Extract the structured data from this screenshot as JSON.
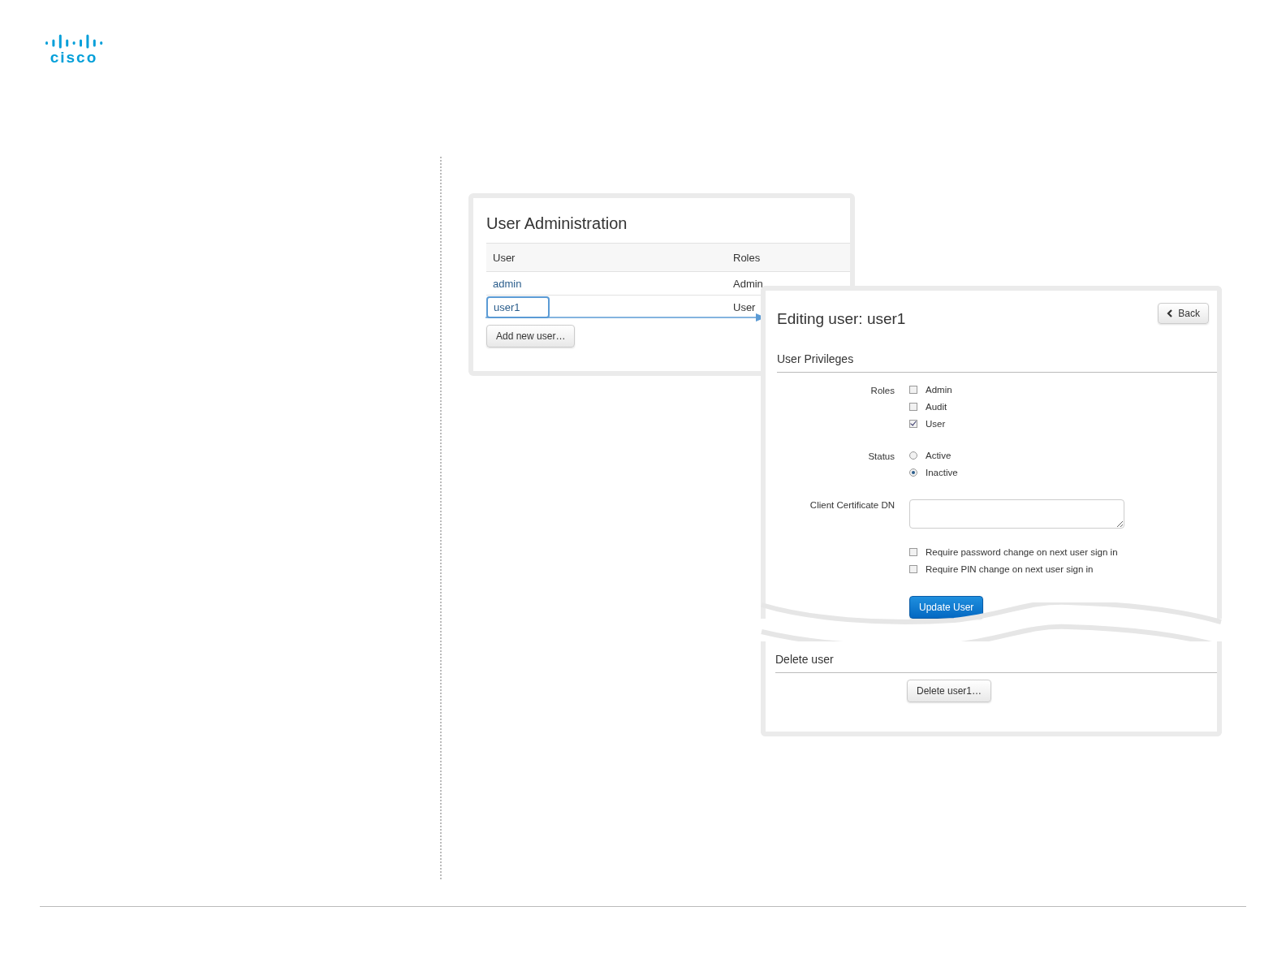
{
  "logo": {
    "text": "cisco"
  },
  "user_administration": {
    "title": "User Administration",
    "columns": [
      "User",
      "Roles"
    ],
    "rows": [
      {
        "user": "admin",
        "roles": "Admin",
        "selected": false
      },
      {
        "user": "user1",
        "roles": "User",
        "selected": true
      }
    ],
    "add_button": "Add new user…"
  },
  "editing_user": {
    "title": "Editing user: user1",
    "back_button": "Back",
    "section": "User Privileges",
    "roles_label": "Roles",
    "roles": [
      {
        "label": "Admin",
        "checked": false
      },
      {
        "label": "Audit",
        "checked": false
      },
      {
        "label": "User",
        "checked": true
      }
    ],
    "status_label": "Status",
    "status": [
      {
        "label": "Active",
        "selected": false
      },
      {
        "label": "Inactive",
        "selected": true
      }
    ],
    "certificate_label": "Client Certificate DN",
    "options": [
      {
        "label": "Require password change on next user sign in",
        "checked": false
      },
      {
        "label": "Require PIN change on next user sign in",
        "checked": false
      }
    ],
    "update_button": "Update User"
  },
  "delete_user": {
    "section": "Delete user",
    "button": "Delete user1…"
  }
}
